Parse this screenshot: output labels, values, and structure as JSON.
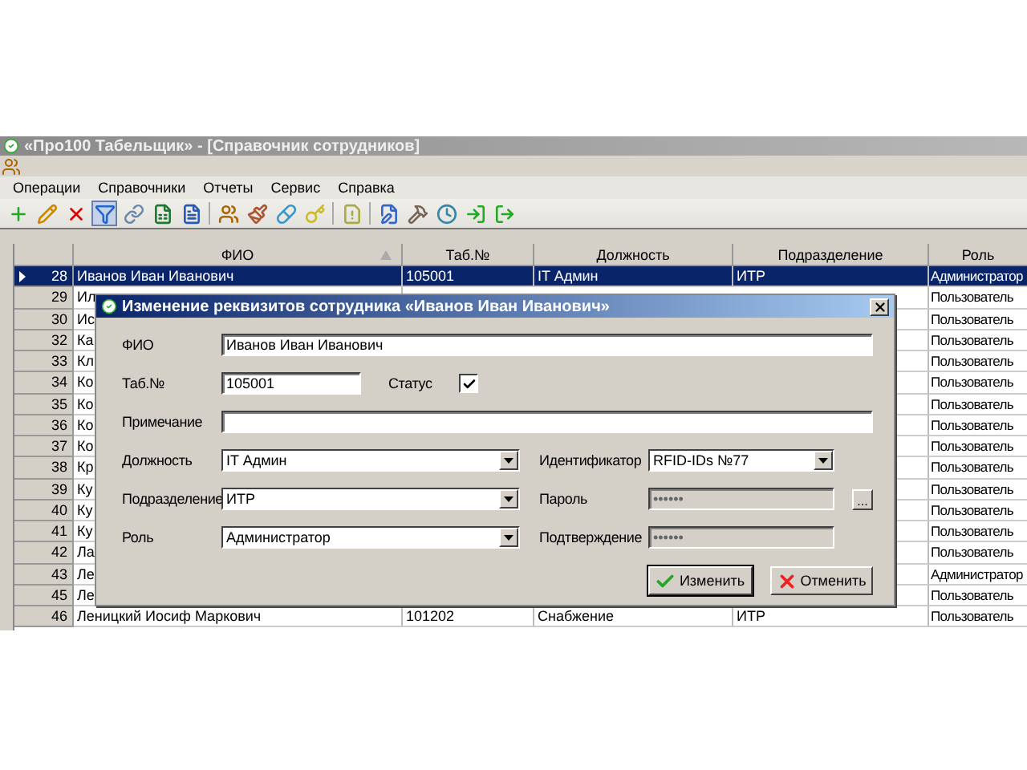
{
  "window": {
    "title": "«Про100 Табельщик» - [Справочник сотрудников]"
  },
  "menu": [
    "Операции",
    "Справочники",
    "Отчеты",
    "Сервис",
    "Справка"
  ],
  "toolbar": [
    {
      "pressed": false
    },
    {
      "pressed": false
    },
    {
      "pressed": false
    },
    {
      "pressed": true
    },
    {
      "pressed": false
    },
    {
      "pressed": false
    },
    {
      "pressed": false
    },
    {
      "pressed": false
    },
    {
      "pressed": false
    },
    {
      "pressed": false
    },
    {
      "pressed": false
    },
    {
      "pressed": false
    },
    {
      "pressed": false
    },
    {
      "pressed": false
    },
    {
      "pressed": false
    },
    {
      "pressed": false
    },
    {
      "pressed": false
    }
  ],
  "table": {
    "columns": [
      "ФИО",
      "Таб.№",
      "Должность",
      "Подразделение",
      "Роль"
    ],
    "rows": [
      {
        "num": "28",
        "fio": "Иванов Иван Иванович",
        "tab": "105001",
        "position": "IT Админ",
        "dept": "ИТР",
        "role": "Администратор",
        "selected": true
      },
      {
        "num": "29",
        "fio": "Ил",
        "role": "Пользователь",
        "selected": false
      },
      {
        "num": "30",
        "fio": "Ис",
        "role": "Пользователь",
        "selected": false
      },
      {
        "num": "32",
        "fio": "Ка",
        "role": "Пользователь",
        "selected": false
      },
      {
        "num": "33",
        "fio": "Кл",
        "role": "Пользователь",
        "selected": false
      },
      {
        "num": "34",
        "fio": "Ко",
        "role": "Пользователь",
        "selected": false
      },
      {
        "num": "35",
        "fio": "Ко",
        "role": "Пользователь",
        "selected": false
      },
      {
        "num": "36",
        "fio": "Ко",
        "role": "Пользователь",
        "selected": false
      },
      {
        "num": "37",
        "fio": "Ко",
        "role": "Пользователь",
        "selected": false
      },
      {
        "num": "38",
        "fio": "Кр",
        "role": "Пользователь",
        "selected": false
      },
      {
        "num": "39",
        "fio": "Ку",
        "role": "Пользователь",
        "selected": false
      },
      {
        "num": "40",
        "fio": "Ку",
        "role": "Пользователь",
        "selected": false
      },
      {
        "num": "41",
        "fio": "Ку",
        "role": "Пользователь",
        "selected": false
      },
      {
        "num": "42",
        "fio": "Ла",
        "role": "Пользователь",
        "selected": false
      },
      {
        "num": "43",
        "fio": "Ле",
        "role": "Администратор",
        "selected": false
      },
      {
        "num": "45",
        "fio": "Ле",
        "role": "Пользователь",
        "selected": false
      },
      {
        "num": "46",
        "fio": "Леницкий Иосиф Маркович",
        "tab": "101202",
        "position": "Снабжение",
        "dept": "ИТР",
        "role": "Пользователь",
        "selected": false
      }
    ]
  },
  "dialog": {
    "title": "Изменение реквизитов сотрудника «Иванов Иван Иванович»",
    "fio": {
      "label": "ФИО",
      "value": "Иванов Иван Иванович"
    },
    "tab": {
      "label": "Таб.№",
      "value": "105001"
    },
    "status": {
      "label": "Статус",
      "checked": true
    },
    "note": {
      "label": "Примечание"
    },
    "position": {
      "label": "Должность",
      "value": "IT Админ"
    },
    "dept": {
      "label": "Подразделение",
      "value": "ИТР"
    },
    "role": {
      "label": "Роль",
      "value": "Администратор"
    },
    "identifier": {
      "label": "Идентификатор",
      "value": "RFID-IDs №77"
    },
    "password": {
      "label": "Пароль",
      "value": "••••••",
      "disabled": true
    },
    "confirm": {
      "label": "Подтверждение",
      "value": "••••••",
      "disabled": true
    },
    "browse": "...",
    "buttons": [
      {
        "kind": "ok",
        "label": "Изменить"
      },
      {
        "kind": "cancel",
        "label": "Отменить"
      }
    ]
  }
}
